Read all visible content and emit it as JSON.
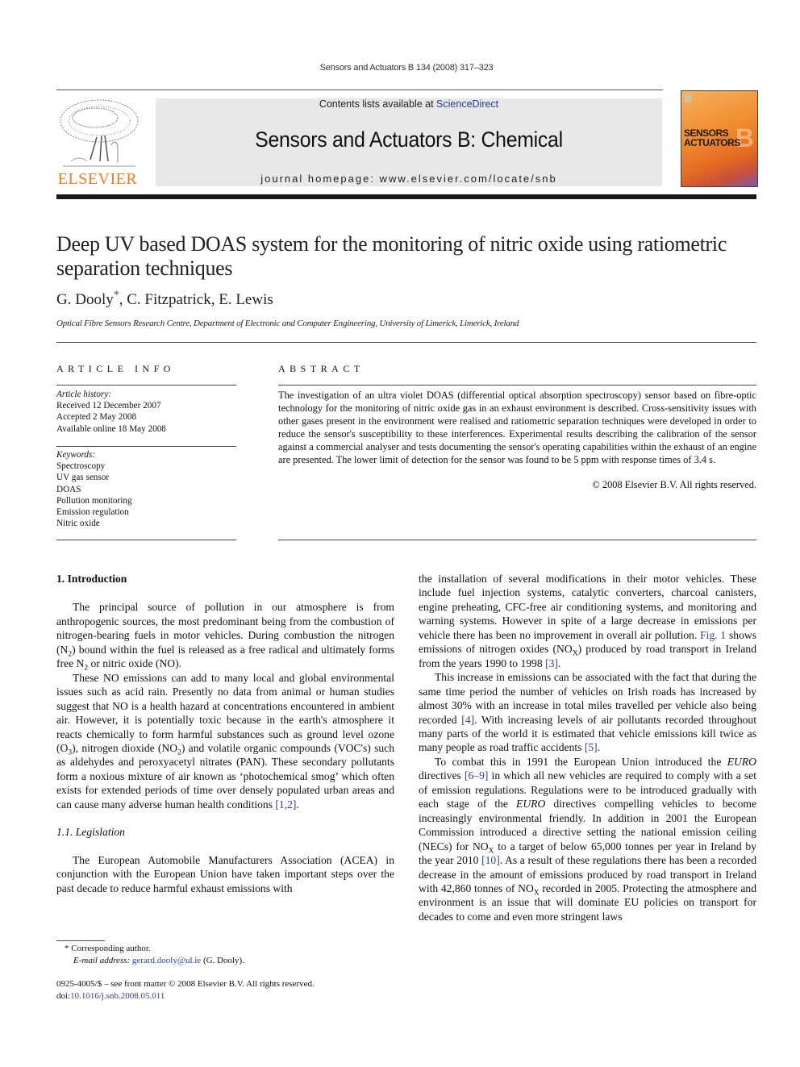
{
  "header": {
    "running_head": "Sensors and Actuators B 134 (2008) 317–323",
    "contents_prefix": "Contents lists available at ",
    "contents_link": "ScienceDirect",
    "journal_title": "Sensors and Actuators B: Chemical",
    "homepage": "journal homepage: www.elsevier.com/locate/snb",
    "publisher_logo_text": "ELSEVIER",
    "cover": {
      "line1": "SENSORS",
      "line2": "ACTUATORS",
      "letter": "B"
    },
    "colors": {
      "elsevier_orange": "#f07c22",
      "link_blue": "#2f3e9e",
      "banner_gray": "#e8e8e8"
    }
  },
  "article": {
    "title": "Deep UV based DOAS system for the monitoring of nitric oxide using ratiometric separation techniques",
    "authors": [
      "G. Dooly",
      "C. Fitzpatrick",
      "E. Lewis"
    ],
    "corresponding_mark": "*",
    "affiliation": "Optical Fibre Sensors Research Centre, Department of Electronic and Computer Engineering, University of Limerick, Limerick, Ireland"
  },
  "article_info": {
    "heading": "ARTICLE INFO",
    "history_label": "Article history:",
    "history": [
      "Received 12 December 2007",
      "Accepted 2 May 2008",
      "Available online 18 May 2008"
    ],
    "keywords_label": "Keywords:",
    "keywords": [
      "Spectroscopy",
      "UV gas sensor",
      "DOAS",
      "Pollution monitoring",
      "Emission regulation",
      "Nitric oxide"
    ]
  },
  "abstract": {
    "heading": "ABSTRACT",
    "text": "The investigation of an ultra violet DOAS (differential optical absorption spectroscopy) sensor based on fibre-optic technology for the monitoring of nitric oxide gas in an exhaust environment is described. Cross-sensitivity issues with other gases present in the environment were realised and ratiometric separation techniques were developed in order to reduce the sensor's susceptibility to these interferences. Experimental results describing the calibration of the sensor against a commercial analyser and tests documenting the sensor's operating capabilities within the exhaust of an engine are presented. The lower limit of detection for the sensor was found to be 5 ppm with response times of 3.4 s.",
    "copyright": "© 2008 Elsevier B.V. All rights reserved."
  },
  "body": {
    "section1_heading": "1.  Introduction",
    "p1": {
      "a": "The principal source of pollution in our atmosphere is from anthropogenic sources, the most predominant being from the combustion of nitrogen-bearing fuels in motor vehicles. During combustion the nitrogen (N",
      "sub1": "2",
      "b": ") bound within the fuel is released as a free radical and ultimately forms free N",
      "sub2": "2",
      "c": " or nitric oxide (NO)."
    },
    "p2": {
      "a": "These NO emissions can add to many local and global environmental issues such as acid rain. Presently no data from animal or human studies suggest that NO is a health hazard at concentrations encountered in ambient air. However, it is potentially toxic because in the earth's atmosphere it reacts chemically to form harmful substances such as ground level ozone (O",
      "sub1": "3",
      "b": "), nitrogen dioxide (NO",
      "sub2": "2",
      "c": ") and volatile organic compounds (VOC's) such as aldehydes and peroxyacetyl nitrates (PAN). These secondary pollutants form a noxious mixture of air known as ‘photochemical smog’ which often exists for extended periods of time over densely populated urban areas and can cause many adverse human health conditions ",
      "ref": "[1,2]",
      "d": "."
    },
    "section11_heading": "1.1.  Legislation",
    "p3": "The European Automobile Manufacturers Association (ACEA) in conjunction with the European Union have taken important steps over the past decade to reduce harmful exhaust emissions with",
    "r1": {
      "a": "the installation of several modifications in their motor vehicles. These include fuel injection systems, catalytic converters, charcoal canisters, engine preheating, CFC-free air conditioning systems, and monitoring and warning systems. However in spite of a large decrease in emissions per vehicle there has been no improvement in overall air pollution. ",
      "fig": "Fig. 1",
      "b": " shows emissions of nitrogen oxides (NO",
      "sub": "X",
      "c": ") produced by road transport in Ireland from the years 1990 to 1998 ",
      "ref": "[3]",
      "d": "."
    },
    "r2": {
      "a": "This increase in emissions can be associated with the fact that during the same time period the number of vehicles on Irish roads has increased by almost 30% with an increase in total miles travelled per vehicle also being recorded ",
      "ref1": "[4]",
      "b": ". With increasing levels of air pollutants recorded throughout many parts of the world it is estimated that vehicle emissions kill twice as many people as road traffic accidents ",
      "ref2": "[5]",
      "c": "."
    },
    "r3": {
      "a": "To combat this in 1991 the European Union introduced the ",
      "euro1": "EURO",
      "b": " directives ",
      "ref1": "[6–9]",
      "c": " in which all new vehicles are required to comply with a set of emission regulations. Regulations were to be introduced gradually with each stage of the ",
      "euro2": "EURO",
      "d": " directives compelling vehicles to become increasingly environmental friendly. In addition in 2001 the European Commission introduced a directive setting the national emission ceiling (NECs) for NO",
      "sub1": "X",
      "e": " to a target of below 65,000 tonnes per year in Ireland by the year 2010 ",
      "ref2": "[10]",
      "f": ". As a result of these regulations there has been a recorded decrease in the amount of emissions produced by road transport in Ireland with 42,860 tonnes of NO",
      "sub2": "X",
      "g": " recorded in 2005. Protecting the atmosphere and environment is an issue that will dominate EU policies on transport for decades to come and even more stringent laws"
    }
  },
  "footnote": {
    "mark": "*",
    "corresponding": "Corresponding author.",
    "email_label": "E-mail address:",
    "email": "gerard.dooly@ul.ie",
    "email_suffix": " (G. Dooly)."
  },
  "issn": {
    "line1": "0925-4005/$ – see front matter © 2008 Elsevier B.V. All rights reserved.",
    "doi_label": "doi:",
    "doi": "10.1016/j.snb.2008.05.011"
  }
}
